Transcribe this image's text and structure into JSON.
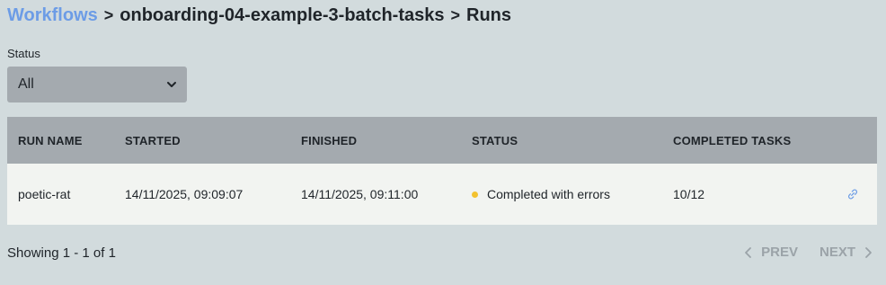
{
  "breadcrumb": {
    "root": "Workflows",
    "workflow": "onboarding-04-example-3-batch-tasks",
    "current": "Runs",
    "separator": ">"
  },
  "filter": {
    "label": "Status",
    "selected": "All"
  },
  "table": {
    "columns": [
      "RUN NAME",
      "STARTED",
      "FINISHED",
      "STATUS",
      "COMPLETED TASKS"
    ],
    "rows": [
      {
        "run_name": "poetic-rat",
        "started": "14/11/2025, 09:09:07",
        "finished": "14/11/2025, 09:11:00",
        "status": "Completed with errors",
        "status_color": "#f3c230",
        "completed_tasks": "10/12",
        "action_icon": "link-icon"
      }
    ]
  },
  "pagination": {
    "summary": "Showing 1 - 1 of 1",
    "prev_label": "PREV",
    "next_label": "NEXT"
  },
  "colors": {
    "background": "#d2dbdd",
    "header": "#a4aaaf",
    "row": "#f2f4f1",
    "link": "#6c9ce6",
    "disabled": "#9ba3a8"
  }
}
